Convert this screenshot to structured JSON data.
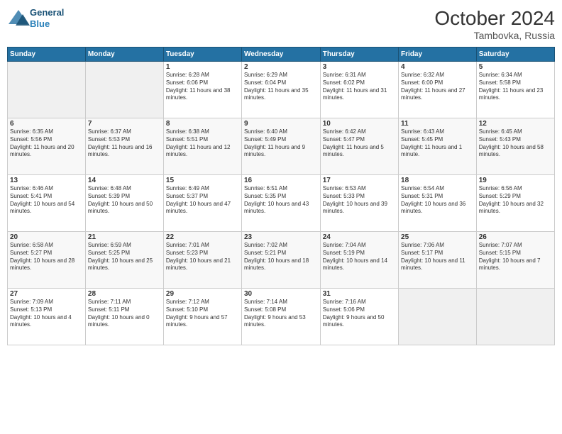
{
  "header": {
    "logo": {
      "line1": "General",
      "line2": "Blue"
    },
    "title": "October 2024",
    "location": "Tambovka, Russia"
  },
  "days_of_week": [
    "Sunday",
    "Monday",
    "Tuesday",
    "Wednesday",
    "Thursday",
    "Friday",
    "Saturday"
  ],
  "weeks": [
    [
      {
        "day": "",
        "sunrise": "",
        "sunset": "",
        "daylight": "",
        "empty": true
      },
      {
        "day": "",
        "sunrise": "",
        "sunset": "",
        "daylight": "",
        "empty": true
      },
      {
        "day": "1",
        "sunrise": "Sunrise: 6:28 AM",
        "sunset": "Sunset: 6:06 PM",
        "daylight": "Daylight: 11 hours and 38 minutes."
      },
      {
        "day": "2",
        "sunrise": "Sunrise: 6:29 AM",
        "sunset": "Sunset: 6:04 PM",
        "daylight": "Daylight: 11 hours and 35 minutes."
      },
      {
        "day": "3",
        "sunrise": "Sunrise: 6:31 AM",
        "sunset": "Sunset: 6:02 PM",
        "daylight": "Daylight: 11 hours and 31 minutes."
      },
      {
        "day": "4",
        "sunrise": "Sunrise: 6:32 AM",
        "sunset": "Sunset: 6:00 PM",
        "daylight": "Daylight: 11 hours and 27 minutes."
      },
      {
        "day": "5",
        "sunrise": "Sunrise: 6:34 AM",
        "sunset": "Sunset: 5:58 PM",
        "daylight": "Daylight: 11 hours and 23 minutes."
      }
    ],
    [
      {
        "day": "6",
        "sunrise": "Sunrise: 6:35 AM",
        "sunset": "Sunset: 5:56 PM",
        "daylight": "Daylight: 11 hours and 20 minutes."
      },
      {
        "day": "7",
        "sunrise": "Sunrise: 6:37 AM",
        "sunset": "Sunset: 5:53 PM",
        "daylight": "Daylight: 11 hours and 16 minutes."
      },
      {
        "day": "8",
        "sunrise": "Sunrise: 6:38 AM",
        "sunset": "Sunset: 5:51 PM",
        "daylight": "Daylight: 11 hours and 12 minutes."
      },
      {
        "day": "9",
        "sunrise": "Sunrise: 6:40 AM",
        "sunset": "Sunset: 5:49 PM",
        "daylight": "Daylight: 11 hours and 9 minutes."
      },
      {
        "day": "10",
        "sunrise": "Sunrise: 6:42 AM",
        "sunset": "Sunset: 5:47 PM",
        "daylight": "Daylight: 11 hours and 5 minutes."
      },
      {
        "day": "11",
        "sunrise": "Sunrise: 6:43 AM",
        "sunset": "Sunset: 5:45 PM",
        "daylight": "Daylight: 11 hours and 1 minute."
      },
      {
        "day": "12",
        "sunrise": "Sunrise: 6:45 AM",
        "sunset": "Sunset: 5:43 PM",
        "daylight": "Daylight: 10 hours and 58 minutes."
      }
    ],
    [
      {
        "day": "13",
        "sunrise": "Sunrise: 6:46 AM",
        "sunset": "Sunset: 5:41 PM",
        "daylight": "Daylight: 10 hours and 54 minutes."
      },
      {
        "day": "14",
        "sunrise": "Sunrise: 6:48 AM",
        "sunset": "Sunset: 5:39 PM",
        "daylight": "Daylight: 10 hours and 50 minutes."
      },
      {
        "day": "15",
        "sunrise": "Sunrise: 6:49 AM",
        "sunset": "Sunset: 5:37 PM",
        "daylight": "Daylight: 10 hours and 47 minutes."
      },
      {
        "day": "16",
        "sunrise": "Sunrise: 6:51 AM",
        "sunset": "Sunset: 5:35 PM",
        "daylight": "Daylight: 10 hours and 43 minutes."
      },
      {
        "day": "17",
        "sunrise": "Sunrise: 6:53 AM",
        "sunset": "Sunset: 5:33 PM",
        "daylight": "Daylight: 10 hours and 39 minutes."
      },
      {
        "day": "18",
        "sunrise": "Sunrise: 6:54 AM",
        "sunset": "Sunset: 5:31 PM",
        "daylight": "Daylight: 10 hours and 36 minutes."
      },
      {
        "day": "19",
        "sunrise": "Sunrise: 6:56 AM",
        "sunset": "Sunset: 5:29 PM",
        "daylight": "Daylight: 10 hours and 32 minutes."
      }
    ],
    [
      {
        "day": "20",
        "sunrise": "Sunrise: 6:58 AM",
        "sunset": "Sunset: 5:27 PM",
        "daylight": "Daylight: 10 hours and 28 minutes."
      },
      {
        "day": "21",
        "sunrise": "Sunrise: 6:59 AM",
        "sunset": "Sunset: 5:25 PM",
        "daylight": "Daylight: 10 hours and 25 minutes."
      },
      {
        "day": "22",
        "sunrise": "Sunrise: 7:01 AM",
        "sunset": "Sunset: 5:23 PM",
        "daylight": "Daylight: 10 hours and 21 minutes."
      },
      {
        "day": "23",
        "sunrise": "Sunrise: 7:02 AM",
        "sunset": "Sunset: 5:21 PM",
        "daylight": "Daylight: 10 hours and 18 minutes."
      },
      {
        "day": "24",
        "sunrise": "Sunrise: 7:04 AM",
        "sunset": "Sunset: 5:19 PM",
        "daylight": "Daylight: 10 hours and 14 minutes."
      },
      {
        "day": "25",
        "sunrise": "Sunrise: 7:06 AM",
        "sunset": "Sunset: 5:17 PM",
        "daylight": "Daylight: 10 hours and 11 minutes."
      },
      {
        "day": "26",
        "sunrise": "Sunrise: 7:07 AM",
        "sunset": "Sunset: 5:15 PM",
        "daylight": "Daylight: 10 hours and 7 minutes."
      }
    ],
    [
      {
        "day": "27",
        "sunrise": "Sunrise: 7:09 AM",
        "sunset": "Sunset: 5:13 PM",
        "daylight": "Daylight: 10 hours and 4 minutes."
      },
      {
        "day": "28",
        "sunrise": "Sunrise: 7:11 AM",
        "sunset": "Sunset: 5:11 PM",
        "daylight": "Daylight: 10 hours and 0 minutes."
      },
      {
        "day": "29",
        "sunrise": "Sunrise: 7:12 AM",
        "sunset": "Sunset: 5:10 PM",
        "daylight": "Daylight: 9 hours and 57 minutes."
      },
      {
        "day": "30",
        "sunrise": "Sunrise: 7:14 AM",
        "sunset": "Sunset: 5:08 PM",
        "daylight": "Daylight: 9 hours and 53 minutes."
      },
      {
        "day": "31",
        "sunrise": "Sunrise: 7:16 AM",
        "sunset": "Sunset: 5:06 PM",
        "daylight": "Daylight: 9 hours and 50 minutes."
      },
      {
        "day": "",
        "sunrise": "",
        "sunset": "",
        "daylight": "",
        "empty": true
      },
      {
        "day": "",
        "sunrise": "",
        "sunset": "",
        "daylight": "",
        "empty": true
      }
    ]
  ]
}
